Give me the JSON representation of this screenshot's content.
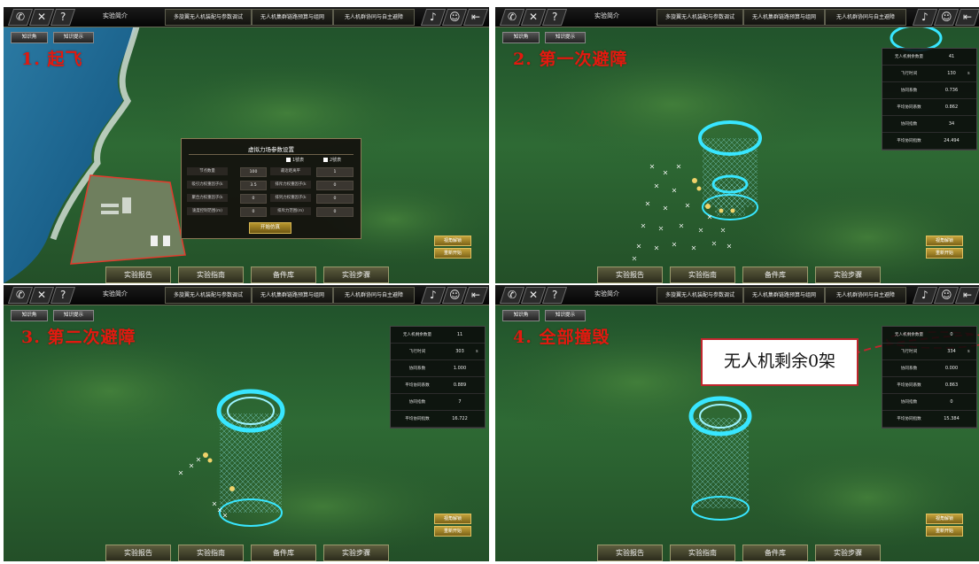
{
  "toolbar_tabs": {
    "intro": "实验简介",
    "tab1": "多旋翼无人机装配与参数调试",
    "tab2": "无人机集群链路预算与组网",
    "tab3": "无人机群协同与自主避障"
  },
  "knowledge_buttons": [
    "知识角",
    "知识提示"
  ],
  "bottom_buttons": [
    "实验报告",
    "实验指南",
    "备件库",
    "实验步骤"
  ],
  "side_buttons": [
    "视角解锁",
    "重新开始"
  ],
  "icons": [
    "phone-icon",
    "tools-icon",
    "help-icon",
    "music-icon",
    "user-icon",
    "exit-icon"
  ],
  "panels": [
    {
      "step_label": "1. 起飞"
    },
    {
      "step_label": "2. 第一次避障"
    },
    {
      "step_label": "3. 第二次避障"
    },
    {
      "step_label": "4. 全部撞毁"
    }
  ],
  "dialog": {
    "title": "虚拟力场参数设置",
    "check1": "1號表",
    "check2": "2號表",
    "rows": [
      [
        "节点数量",
        "100",
        "最近距离平",
        "1"
      ],
      [
        "吸引力权重因子(k",
        "3.5",
        "排斥力权重因子(k",
        "0"
      ],
      [
        "聚合力权重因子(k",
        "0",
        "排列力权重因子(k",
        "0"
      ],
      [
        "速度控制范围(m)",
        "0",
        "排斥力范围(m)",
        "0"
      ]
    ],
    "start_button": "开始仿真"
  },
  "stats_labels": [
    "无人机剩余数量",
    "飞行时间",
    "协同系数",
    "平均协同系数",
    "协同指数",
    "平均协同指数"
  ],
  "stats_unit": "s",
  "stats": [
    [
      "41",
      "130",
      "0.736",
      "0.862",
      "34",
      "24.494"
    ],
    [
      "11",
      "303",
      "1.000",
      "0.889",
      "7",
      "16.722"
    ],
    [
      "0",
      "334",
      "0.000",
      "0.863",
      "0",
      "15.384"
    ]
  ],
  "callout_text": "无人机剩余0架",
  "colors": {
    "step_label": "#e3190f",
    "accent_cyan": "#38e6ff",
    "callout_border": "#c0262e"
  }
}
